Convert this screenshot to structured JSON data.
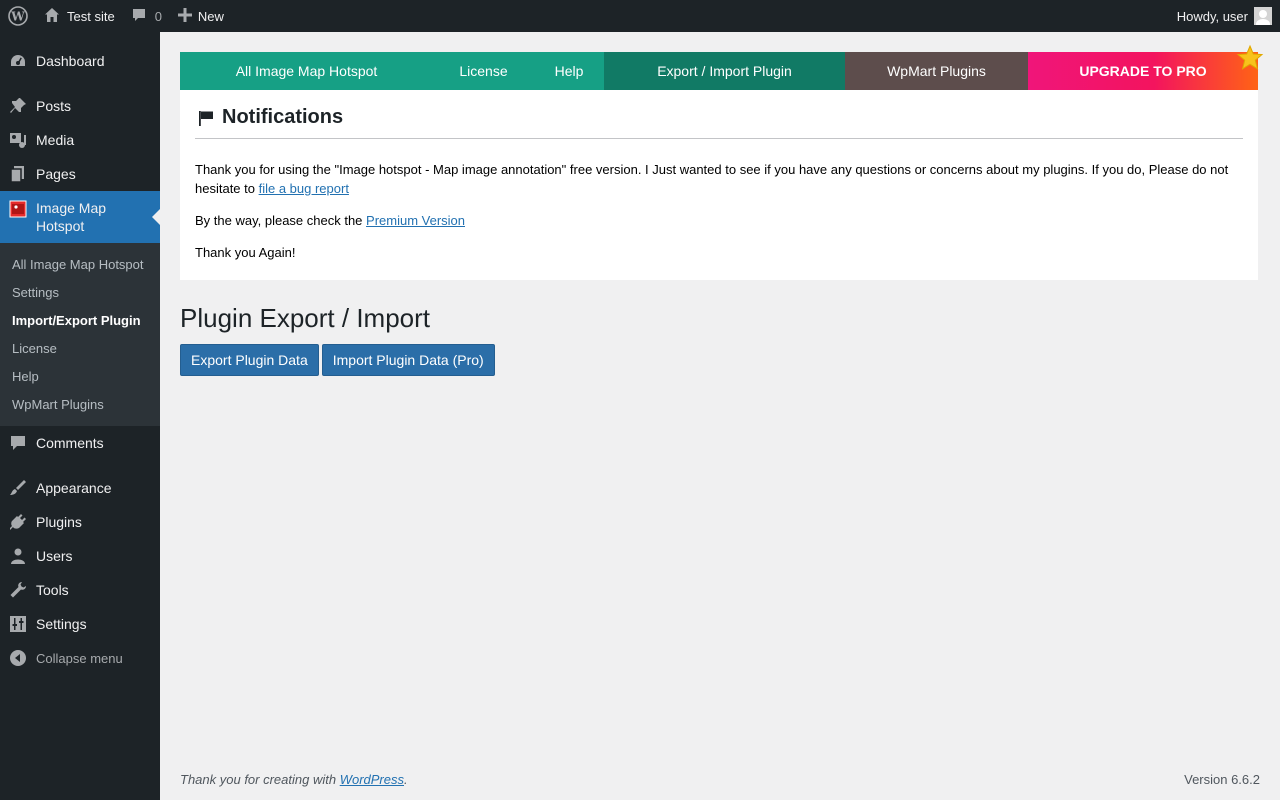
{
  "admin_bar": {
    "site_name": "Test site",
    "comments_count": "0",
    "new_label": "New",
    "greeting": "Howdy, user"
  },
  "sidebar": {
    "items_top": [
      {
        "label": "Dashboard",
        "icon": "dashboard-icon"
      },
      {
        "label": "Posts",
        "icon": "pin-icon"
      },
      {
        "label": "Media",
        "icon": "media-icon"
      },
      {
        "label": "Pages",
        "icon": "pages-icon"
      }
    ],
    "current": {
      "label": "Image Map Hotspot",
      "icon": "image-map-icon"
    },
    "submenu": [
      {
        "label": "All Image Map Hotspot"
      },
      {
        "label": "Settings"
      },
      {
        "label": "Import/Export Plugin"
      },
      {
        "label": "License"
      },
      {
        "label": "Help"
      },
      {
        "label": "WpMart Plugins"
      }
    ],
    "items_bottom": [
      {
        "label": "Comments",
        "icon": "comment-icon"
      },
      {
        "label": "Appearance",
        "icon": "brush-icon"
      },
      {
        "label": "Plugins",
        "icon": "plug-icon"
      },
      {
        "label": "Users",
        "icon": "user-icon"
      },
      {
        "label": "Tools",
        "icon": "wrench-icon"
      },
      {
        "label": "Settings",
        "icon": "settings-icon"
      }
    ],
    "collapse_label": "Collapse menu"
  },
  "tabs": [
    {
      "label": "All Image Map Hotspot"
    },
    {
      "label": "License"
    },
    {
      "label": "Help"
    },
    {
      "label": "Export / Import Plugin"
    },
    {
      "label": "WpMart Plugins"
    },
    {
      "label": "UPGRADE TO PRO"
    }
  ],
  "notice": {
    "title": "Notifications",
    "p1_text": "Thank you for using the \"Image hotspot - Map image annotation\" free version. I Just wanted to see if you have any questions or concerns about my plugins. If you do, Please do not hesitate to ",
    "p1_link": "file a bug report",
    "p2_text": "By the way, please check the ",
    "p2_link": "Premium Version",
    "p3_text": "Thank you Again!"
  },
  "main": {
    "title": "Plugin Export / Import",
    "export_button": "Export Plugin Data",
    "import_button": "Import Plugin Data (Pro)"
  },
  "footer": {
    "thanks_text": "Thank you for creating with ",
    "wp_link": "WordPress",
    "period": ".",
    "version": "Version 6.6.2"
  },
  "colors": {
    "admin_bg": "#1d2327",
    "accent": "#2271b1",
    "tab_green": "#16a085",
    "tab_active": "#117a65",
    "tab_brown": "#5d4d4c",
    "pro_pink": "#f0157a",
    "pro_orange": "#ff6315"
  }
}
